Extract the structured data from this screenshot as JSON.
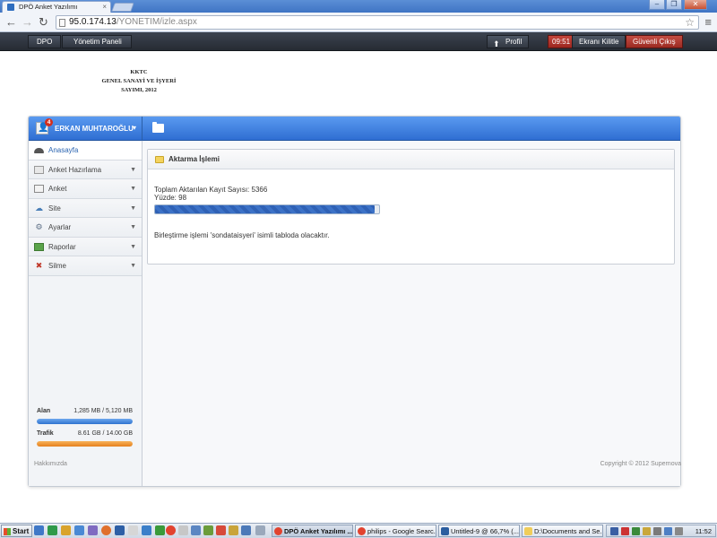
{
  "browser": {
    "tab_title": "DPÖ Anket Yazılımı",
    "tab_close": "×",
    "url_host": "95.0.174.13",
    "url_path": "/YONETIM/izle.aspx",
    "window_controls": [
      "–",
      "❐",
      "✕"
    ]
  },
  "topbar": {
    "crumb_home": "DPO",
    "crumb_panel": "Yönetim Paneli",
    "profile_label": "Profil",
    "timer": "09:51",
    "lock_label": "Ekranı Kilitle",
    "logout_label": "Güvenli Çıkış"
  },
  "census": {
    "line1": "KKTC",
    "line2": "GENEL SANAYİ VE İŞYERİ",
    "line3": "SAYIMI, 2012"
  },
  "user": {
    "name": "ERKAN MUHTAROĞLU",
    "notifications": "4"
  },
  "sidebar": {
    "items": [
      {
        "label": "Anasayfa",
        "icon": "home-icon",
        "caret": ""
      },
      {
        "label": "Anket Hazırlama",
        "icon": "document-icon",
        "caret": "▼"
      },
      {
        "label": "Anket",
        "icon": "list-icon",
        "caret": "▼"
      },
      {
        "label": "Site",
        "icon": "globe-icon",
        "caret": "▼"
      },
      {
        "label": "Ayarlar",
        "icon": "settings-icon",
        "caret": "▼"
      },
      {
        "label": "Raporlar",
        "icon": "report-icon",
        "caret": "▼"
      },
      {
        "label": "Silme",
        "icon": "delete-icon",
        "caret": "▼"
      }
    ]
  },
  "usage": {
    "space_label": "Alan",
    "space_value": "1,285 MB / 5,120 MB",
    "space_fraction": 1.0,
    "traffic_label": "Trafik",
    "traffic_value": "8.61 GB / 14.00 GB",
    "traffic_fraction": 1.0
  },
  "transfer": {
    "title": "Aktarma İşlemi",
    "count_line": "Toplam Aktarılan Kayıt Sayısı: 5366",
    "percent_line": "Yüzde: 98",
    "percent": 98,
    "merge_line": "Birleştirme işlemi 'sondataisyeri' isimli tabloda olacaktır."
  },
  "footer": {
    "about": "Hakkımızda",
    "copyright": "Copyright © 2012 Supernova"
  },
  "taskbar": {
    "start": "Start",
    "tasks": [
      "DPÖ Anket Yazılımı ...",
      "philips - Google Searc...",
      "Untitled-9 @ 66,7% (...",
      "D:\\Documents and Se..."
    ],
    "clock": "11:52"
  },
  "colors": {
    "header_blue": "#2f6ed2",
    "topbar_dark": "#2b3038",
    "logout_red": "#b0362c",
    "progress_blue": "#2f61b5",
    "traffic_orange": "#e5801d"
  }
}
